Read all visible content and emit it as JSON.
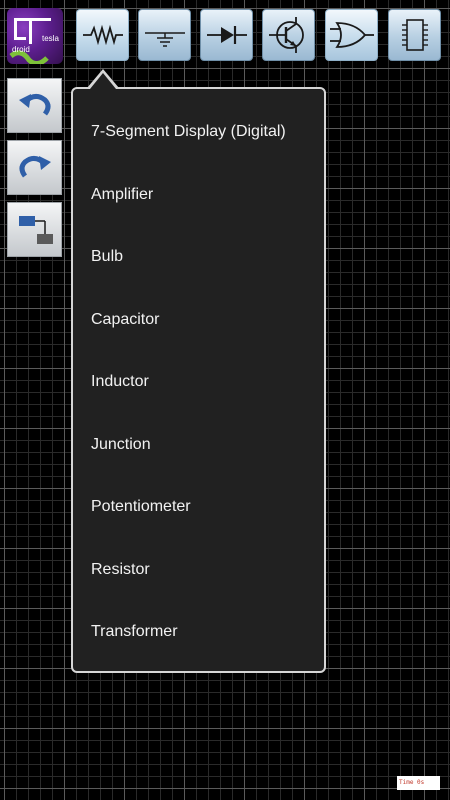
{
  "app": {
    "logo_icon": "everycircuit-droid-tesla-logo"
  },
  "toolbar": {
    "buttons": [
      {
        "id": "passive",
        "icon": "resistor-icon",
        "active": true
      },
      {
        "id": "sources",
        "icon": "ground-icon"
      },
      {
        "id": "diodes",
        "icon": "diode-icon"
      },
      {
        "id": "transistors",
        "icon": "transistor-icon"
      },
      {
        "id": "logic",
        "icon": "or-gate-icon"
      },
      {
        "id": "integrated",
        "icon": "ic-chip-icon"
      }
    ]
  },
  "sidebar": {
    "buttons": [
      {
        "id": "undo",
        "icon": "undo-icon"
      },
      {
        "id": "redo",
        "icon": "redo-icon"
      },
      {
        "id": "wire",
        "icon": "wire-mode-icon"
      }
    ]
  },
  "component_menu": {
    "items": [
      {
        "label": "7-Segment Display (Digital)"
      },
      {
        "label": "Amplifier"
      },
      {
        "label": "Bulb"
      },
      {
        "label": "Capacitor"
      },
      {
        "label": "Inductor"
      },
      {
        "label": "Junction"
      },
      {
        "label": "Potentiometer"
      },
      {
        "label": "Resistor"
      },
      {
        "label": "Transformer"
      }
    ]
  },
  "status": {
    "time_text": "Time 0s"
  },
  "colors": {
    "background": "#000000",
    "grid_major": "#5a5a5a",
    "grid_minor": "#2a2a2a",
    "menu_bg": "#212121",
    "menu_border": "#d6d6d6",
    "toolbar_button": "#b7cfe2",
    "undo_redo_blue": "#2f5fa8"
  }
}
